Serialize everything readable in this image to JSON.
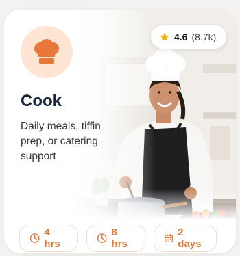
{
  "card": {
    "title": "Cook",
    "description": "Daily meals, tiffin prep, or catering support",
    "icon": "chef-hat-icon",
    "accent_color": "#e8783a",
    "icon_bg_color": "#fde4d3"
  },
  "rating": {
    "score": "4.6",
    "count": "(8.7k)",
    "icon": "star-icon",
    "star_color": "#f2b01e"
  },
  "durations": [
    {
      "label": "4 hrs",
      "icon": "clock-icon"
    },
    {
      "label": "8 hrs",
      "icon": "clock-icon"
    },
    {
      "label": "2 days",
      "icon": "calendar-icon"
    }
  ]
}
